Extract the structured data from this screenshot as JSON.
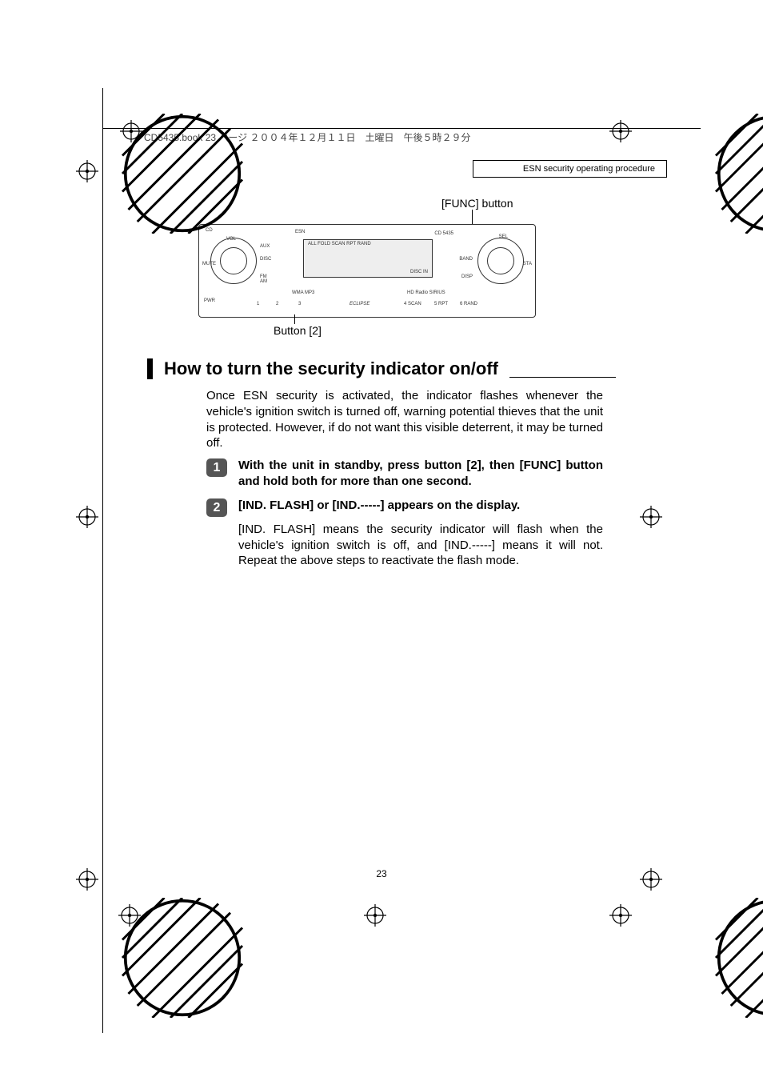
{
  "header_strip": "CD5435.book  23 ページ  ２００４年１２月１１日　土曜日　午後５時２９分",
  "topic_box": "ESN security operating procedure",
  "callouts": {
    "func_button": "[FUNC] button",
    "button_2": "Button [2]"
  },
  "device": {
    "model": "CD 5435",
    "brand_small": "ESN",
    "vol": "VOL",
    "cd": "CD",
    "aux": "AUX",
    "disc": "DISC",
    "mute": "MUTE",
    "fm_am": "FM\nAM",
    "pwr": "PWR",
    "sel": "SEL",
    "band": "BAND",
    "disp": "DISP",
    "sta": "STA",
    "display_row": "ALL  FOLD  SCAN  RPT  RAND",
    "disc_in": "DISC IN",
    "badges": "WMA  MP3",
    "eclipse": "ECLIPSE",
    "hd": "HD Radio  SIRIUS",
    "btn1": "1",
    "btn2": "2",
    "btn3": "3",
    "btn4": "4  SCAN",
    "btn5": "5    RPT",
    "btn6": "6  RAND"
  },
  "heading": "How to turn the security indicator on/off",
  "intro": "Once ESN security is activated, the indicator flashes whenever the vehicle's ignition switch is turned off, warning potential thieves that the unit is protected. However, if do not want this visible deterrent, it may be turned off.",
  "steps": [
    {
      "num": "1",
      "title": "With the unit in standby, press button [2], then [FUNC] button and hold both for more than one second.",
      "body": ""
    },
    {
      "num": "2",
      "title": "[IND. FLASH] or [IND.-----] appears on the display.",
      "body": "[IND. FLASH] means the security indicator will flash when the vehicle's ignition switch is off, and [IND.-----] means it will not. Repeat the above steps to reactivate the flash mode."
    }
  ],
  "page_number": "23"
}
